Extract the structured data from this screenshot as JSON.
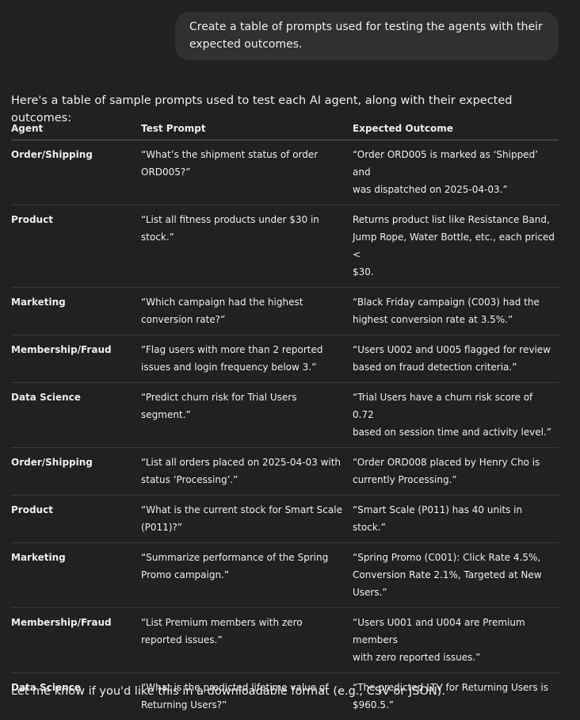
{
  "user_message": "Create a table of prompts used for testing the agents with their\nexpected outcomes.",
  "assistant": {
    "intro": "Here's a table of sample prompts used to test each AI agent, along with their expected outcomes:",
    "table": {
      "headers": [
        "Agent",
        "Test Prompt",
        "Expected Outcome"
      ],
      "rows": [
        {
          "agent": "Order/Shipping",
          "prompt": "“What’s the shipment status of order\nORD005?”",
          "outcome": "“Order ORD005 is marked as ‘Shipped’ and\nwas dispatched on 2025-04-03.”"
        },
        {
          "agent": "Product",
          "prompt": "“List all fitness products under $30 in\nstock.”",
          "outcome": "Returns product list like Resistance Band,\nJump Rope, Water Bottle, etc., each priced <\n$30."
        },
        {
          "agent": "Marketing",
          "prompt": "“Which campaign had the highest\nconversion rate?”",
          "outcome": "“Black Friday campaign (C003) had the\nhighest conversion rate at 3.5%.”"
        },
        {
          "agent": "Membership/Fraud",
          "prompt": "“Flag users with more than 2 reported\nissues and login frequency below 3.”",
          "outcome": "“Users U002 and U005 flagged for review\nbased on fraud detection criteria.”"
        },
        {
          "agent": "Data Science",
          "prompt": "“Predict churn risk for Trial Users\nsegment.”",
          "outcome": "“Trial Users have a churn risk score of 0.72\nbased on session time and activity level.”"
        },
        {
          "agent": "Order/Shipping",
          "prompt": "“List all orders placed on 2025-04-03 with\nstatus ‘Processing’.”",
          "outcome": "“Order ORD008 placed by Henry Cho is\ncurrently Processing.”"
        },
        {
          "agent": "Product",
          "prompt": "“What is the current stock for Smart Scale\n(P011)?”",
          "outcome": "“Smart Scale (P011) has 40 units in stock.”"
        },
        {
          "agent": "Marketing",
          "prompt": "“Summarize performance of the Spring\nPromo campaign.”",
          "outcome": "“Spring Promo (C001): Click Rate 4.5%,\nConversion Rate 2.1%, Targeted at New\nUsers.”"
        },
        {
          "agent": "Membership/Fraud",
          "prompt": "“List Premium members with zero\nreported issues.”",
          "outcome": "“Users U001 and U004 are Premium members\nwith zero reported issues.”"
        },
        {
          "agent": "Data Science",
          "prompt": "“What is the predicted lifetime value of\nReturning Users?”",
          "outcome": "“The predicted LTV for Returning Users is\n$960.5.”"
        }
      ]
    },
    "outro": "Let me know if you'd like this in a downloadable format (e.g., CSV or JSON)."
  }
}
